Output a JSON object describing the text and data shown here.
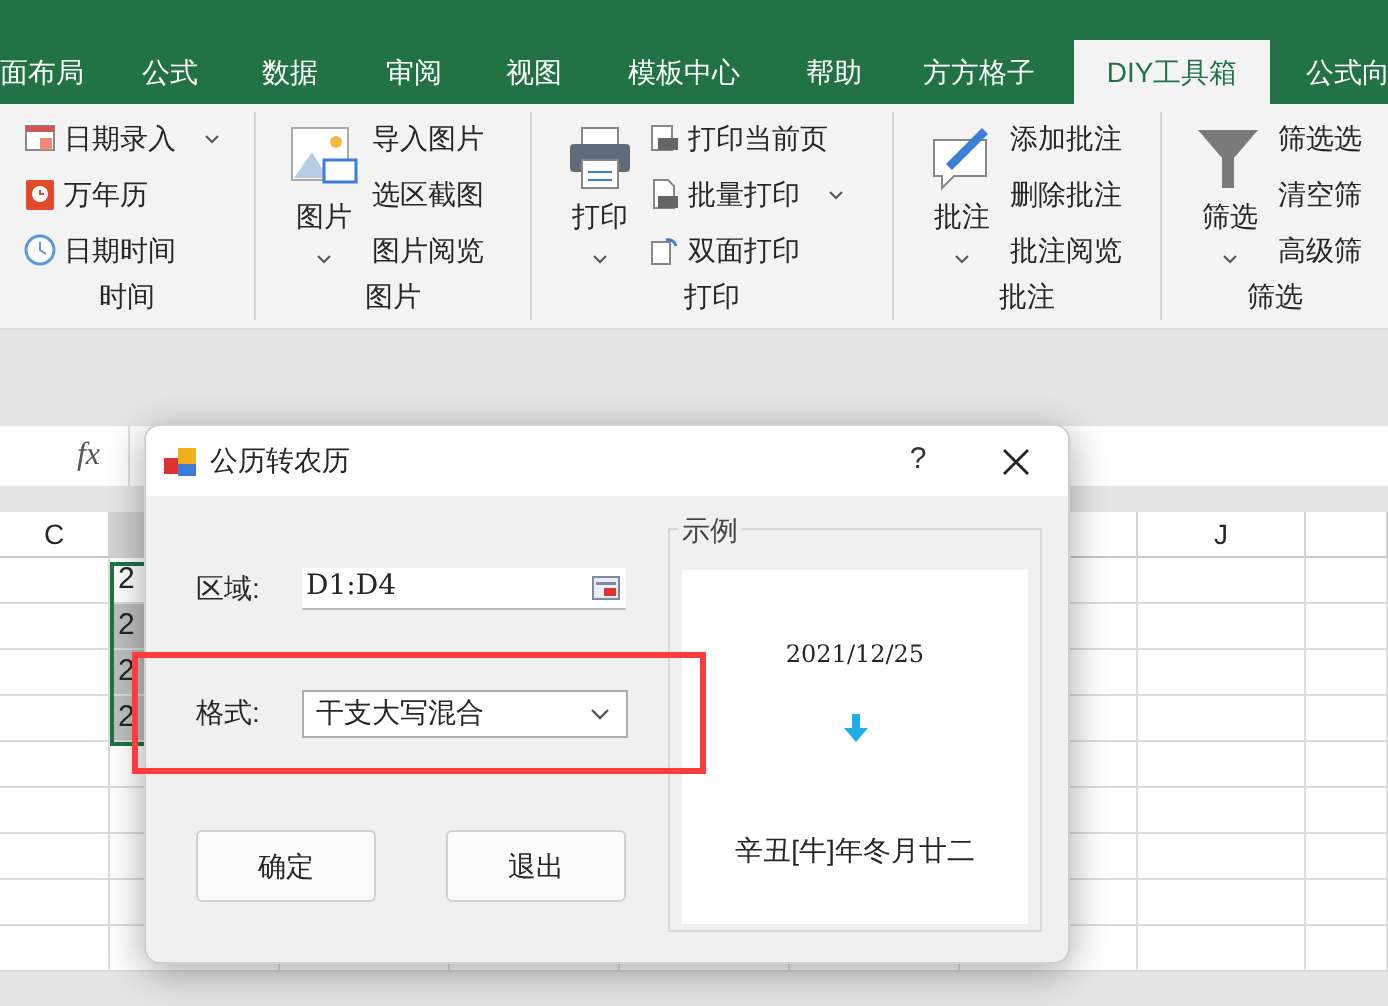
{
  "ribbon_tabs": [
    {
      "label": "面布局",
      "selected": false
    },
    {
      "label": "公式",
      "selected": false
    },
    {
      "label": "数据",
      "selected": false
    },
    {
      "label": "审阅",
      "selected": false
    },
    {
      "label": "视图",
      "selected": false
    },
    {
      "label": "模板中心",
      "selected": false
    },
    {
      "label": "帮助",
      "selected": false
    },
    {
      "label": "方方格子",
      "selected": false
    },
    {
      "label": "DIY工具箱",
      "selected": true
    },
    {
      "label": "公式向",
      "selected": false
    }
  ],
  "ribbon_groups": [
    {
      "label": "时间",
      "items": [
        {
          "label": "日期录入",
          "caret": true
        },
        {
          "label": "万年历",
          "caret": false
        },
        {
          "label": "日期时间",
          "caret": false
        }
      ]
    },
    {
      "label": "图片",
      "large": {
        "label": "图片",
        "caret": true
      },
      "items": [
        {
          "label": "导入图片",
          "caret": false
        },
        {
          "label": "选区截图",
          "caret": false
        },
        {
          "label": "图片阅览",
          "caret": false
        }
      ]
    },
    {
      "label": "打印",
      "large": {
        "label": "打印",
        "caret": true
      },
      "items": [
        {
          "label": "打印当前页",
          "caret": false
        },
        {
          "label": "批量打印",
          "caret": true
        },
        {
          "label": "双面打印",
          "caret": false
        }
      ]
    },
    {
      "label": "批注",
      "large": {
        "label": "批注",
        "caret": true
      },
      "items": [
        {
          "label": "添加批注",
          "caret": false
        },
        {
          "label": "删除批注",
          "caret": false
        },
        {
          "label": "批注阅览",
          "caret": false
        }
      ]
    },
    {
      "label": "筛选",
      "large": {
        "label": "筛选",
        "caret": true
      },
      "items": [
        {
          "label": "筛选选",
          "caret": false
        },
        {
          "label": "清空筛",
          "caret": false
        },
        {
          "label": "高级筛",
          "caret": false
        }
      ]
    }
  ],
  "formula_bar": {
    "fx": "fx"
  },
  "column_headers": [
    "C",
    "J"
  ],
  "cells": [
    {
      "text": "2",
      "selected": false
    },
    {
      "text": "2",
      "selected": true
    },
    {
      "text": "2",
      "selected": true
    },
    {
      "text": "2",
      "selected": true
    }
  ],
  "dialog": {
    "title": "公历转农历",
    "help": "?",
    "region": {
      "label": "区域:",
      "value": "D1:D4"
    },
    "format": {
      "label": "格式:",
      "value": "干支大写混合"
    },
    "buttons": [
      "确定",
      "退出"
    ],
    "example": {
      "legend": "示例",
      "date": "2021/12/25",
      "result": "辛丑[牛]年冬月廿二"
    }
  }
}
